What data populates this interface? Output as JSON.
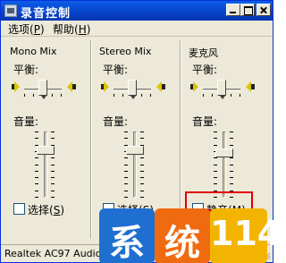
{
  "window": {
    "title": "录音控制"
  },
  "menu": [
    {
      "label": "选项",
      "key": "P"
    },
    {
      "label": "帮助",
      "key": "H"
    }
  ],
  "panels": [
    {
      "title": "Mono Mix",
      "balance_label": "平衡:",
      "volume_label": "音量:",
      "volume_level_percent": 75,
      "checkbox_label": "选择",
      "checkbox_key": "S",
      "checked": false
    },
    {
      "title": "Stereo Mix",
      "balance_label": "平衡:",
      "volume_label": "音量:",
      "volume_level_percent": 75,
      "checkbox_label": "选择",
      "checkbox_key": "S",
      "checked": false
    },
    {
      "title": "麦克风",
      "balance_label": "平衡:",
      "volume_label": "音量:",
      "volume_level_percent": 70,
      "checkbox_label": "静音",
      "checkbox_key": "M",
      "checked": false
    }
  ],
  "status": {
    "text": "Realtek AC97 Audio"
  },
  "watermark": {
    "chars": [
      "系",
      "统",
      "114"
    ],
    "colors": [
      "#1f6fd1",
      "#f06a0f",
      "#f3b400"
    ]
  }
}
